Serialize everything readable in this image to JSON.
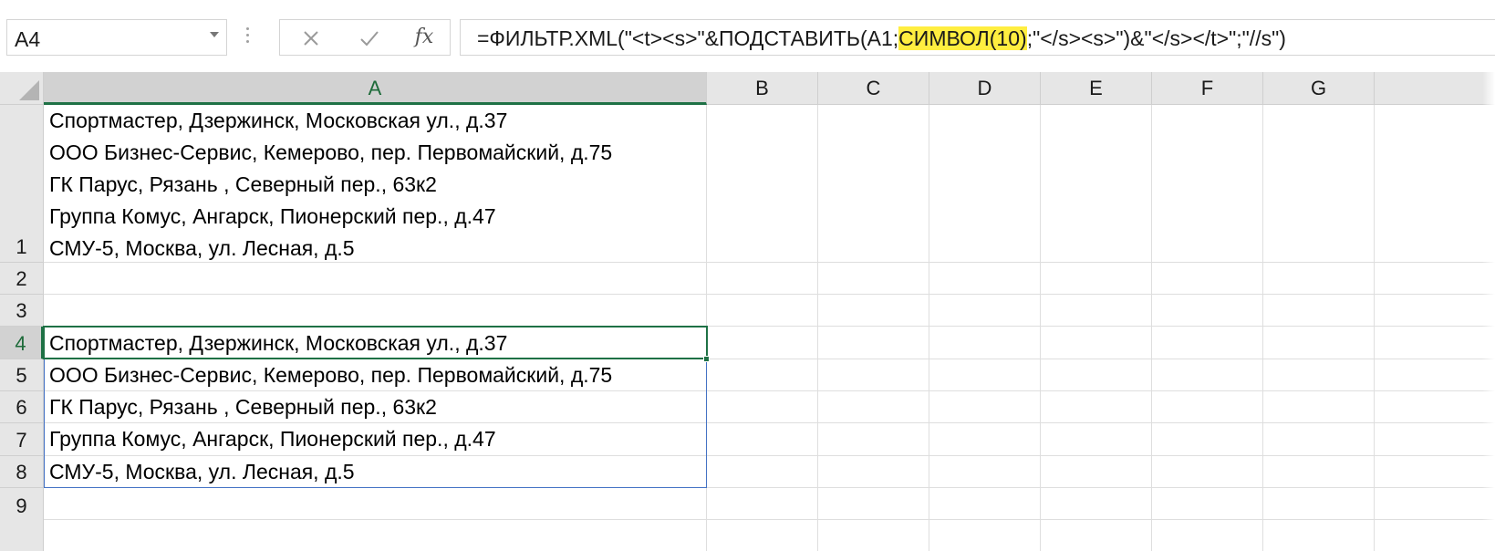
{
  "formula_bar": {
    "name_box": "A4",
    "fx_label": "fx",
    "formula_before": "=ФИЛЬТР.XML(\"<t><s>\"&ПОДСТАВИТЬ(A1;",
    "formula_highlight": "СИМВОЛ(10)",
    "formula_after": ";\"</s><s>\")&\"</s></t>\";\"//s\")"
  },
  "columns": [
    "A",
    "B",
    "C",
    "D",
    "E",
    "F",
    "G"
  ],
  "active_column": "A",
  "rows": [
    "1",
    "2",
    "3",
    "4",
    "5",
    "6",
    "7",
    "8",
    "9"
  ],
  "active_row": "4",
  "cell_a1_lines": [
    "Спортмастер, Дзержинск, Московская ул., д.37",
    "ООО Бизнес-Сервис, Кемерово, пер. Первомайский, д.75",
    "ГК Парус, Рязань  , Северный пер., 63к2",
    "Группа Комус, Ангарск, Пионерский пер., д.47",
    "СМУ-5, Москва, ул. Лесная, д.5"
  ],
  "spill_cells": [
    "Спортмастер, Дзержинск, Московская ул., д.37",
    "ООО Бизнес-Сервис, Кемерово, пер. Первомайский, д.75",
    "ГК Парус, Рязань  , Северный пер., 63к2",
    "Группа Комус, Ангарск, Пионерский пер., д.47",
    "СМУ-5, Москва, ул. Лесная, д.5"
  ],
  "colors": {
    "selection": "#1e7145",
    "spill_border": "#4472c4",
    "highlight": "#ffee40"
  }
}
